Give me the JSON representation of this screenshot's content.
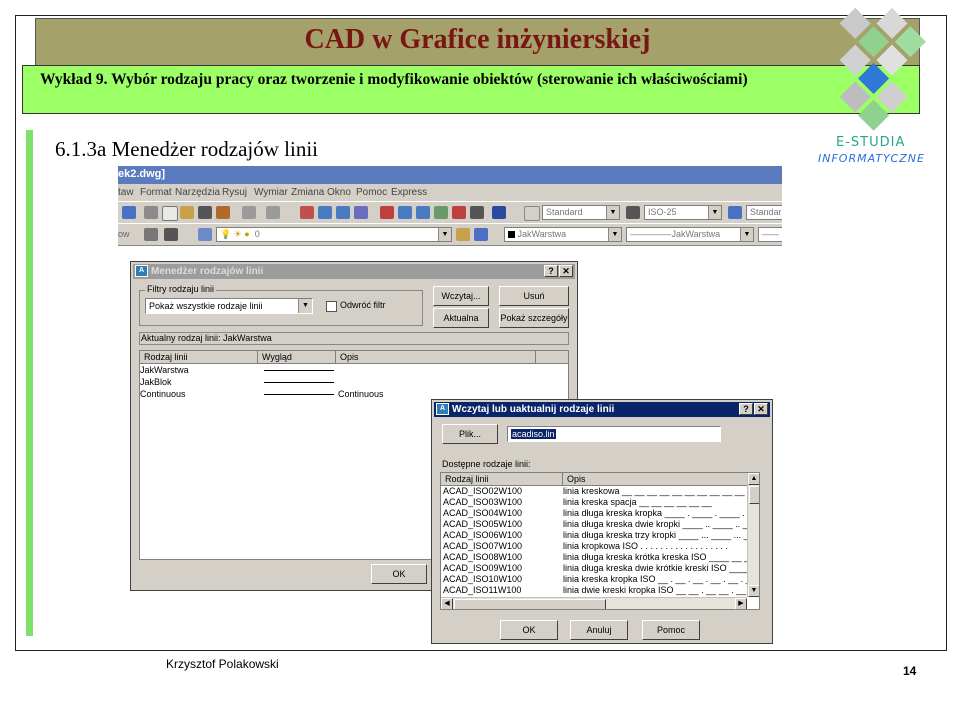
{
  "slide": {
    "title": "CAD w Grafice inżynierskiej",
    "subtitle": "Wykład 9.  Wybór rodzaju pracy oraz tworzenie i modyfikowanie obiektów (sterowanie ich właściwościami)",
    "section": "6.1.3a Menedżer rodzajów linii",
    "author": "Krzysztof Polakowski",
    "page": "14",
    "logo": {
      "line1": "E-STUDIA",
      "line2": "INFORMATYCZNE"
    },
    "colors": {
      "title_band": "#a4a26a",
      "title_text": "#7a1515",
      "subtitle_band": "#9cff66",
      "accent_bar": "#7fe06a"
    }
  },
  "cad_window": {
    "title": "ek2.dwg]",
    "menu": [
      "taw",
      "Format",
      "Narzędzia",
      "Rysuj",
      "Wymiar",
      "Zmiana",
      "Okno",
      "Pomoc",
      "Express"
    ],
    "toolbar1": {
      "text_style": "Standard",
      "dim_style": "ISO-25",
      "table_style": "Standar"
    },
    "toolbar2": {
      "layer_prefix": "ow",
      "layer": "0",
      "color": "JakWarstwa",
      "linetype": "JakWarstwa",
      "lineweight": ""
    }
  },
  "linetype_manager": {
    "title": "Menedżer rodzajów linii",
    "filters_group": "Filtry rodzaju linii",
    "filter_value": "Pokaż wszystkie rodzaje linii",
    "invert_filter": "Odwróć filtr",
    "buttons": {
      "load": "Wczytaj...",
      "delete": "Usuń",
      "current": "Aktualna",
      "details": "Pokaż szczegóły",
      "ok": "OK"
    },
    "current_label": "Aktualny rodzaj linii:  JakWarstwa",
    "columns": [
      "Rodzaj linii",
      "Wygląd",
      "Opis"
    ],
    "rows": [
      {
        "name": "JakWarstwa",
        "desc": ""
      },
      {
        "name": "JakBlok",
        "desc": ""
      },
      {
        "name": "Continuous",
        "desc": "Continuous"
      }
    ]
  },
  "load_dialog": {
    "title": "Wczytaj lub uaktualnij rodzaje linii",
    "file_button": "Plik...",
    "file_value": "acadiso.lin",
    "available_label": "Dostępne rodzaje linii:",
    "columns": [
      "Rodzaj linii",
      "Opis"
    ],
    "rows": [
      {
        "name": "ACAD_ISO02W100",
        "desc": "linia kreskowa __ __ __ __ __ __ __ __ __ __ __ __"
      },
      {
        "name": "ACAD_ISO03W100",
        "desc": "linia kreska spacja __    __    __    __    __    __"
      },
      {
        "name": "ACAD_ISO04W100",
        "desc": "linia długa kreska kropka ____ . ____ . ____ . ____ . _"
      },
      {
        "name": "ACAD_ISO05W100",
        "desc": "linia długa kreska dwie kropki ____ .. ____ .. ____ .."
      },
      {
        "name": "ACAD_ISO06W100",
        "desc": "linia długa kreska trzy kropki ____ ... ____ ... ____"
      },
      {
        "name": "ACAD_ISO07W100",
        "desc": "linia kropkowa ISO . . . . . . . . . . . . . . . . . ."
      },
      {
        "name": "ACAD_ISO08W100",
        "desc": "linia długa kreska krótka kreska ISO ____ __ ____ __"
      },
      {
        "name": "ACAD_ISO09W100",
        "desc": "linia długa kreska dwie krótkie kreski ISO ____ __ __"
      },
      {
        "name": "ACAD_ISO10W100",
        "desc": "linia kreska kropka ISO __ . __ . __ . __ . __ . __ ."
      },
      {
        "name": "ACAD_ISO11W100",
        "desc": "linia dwie kreski kropka ISO __ __ . __ __ . __ __ ."
      }
    ],
    "buttons": {
      "ok": "OK",
      "cancel": "Anuluj",
      "help": "Pomoc"
    }
  }
}
